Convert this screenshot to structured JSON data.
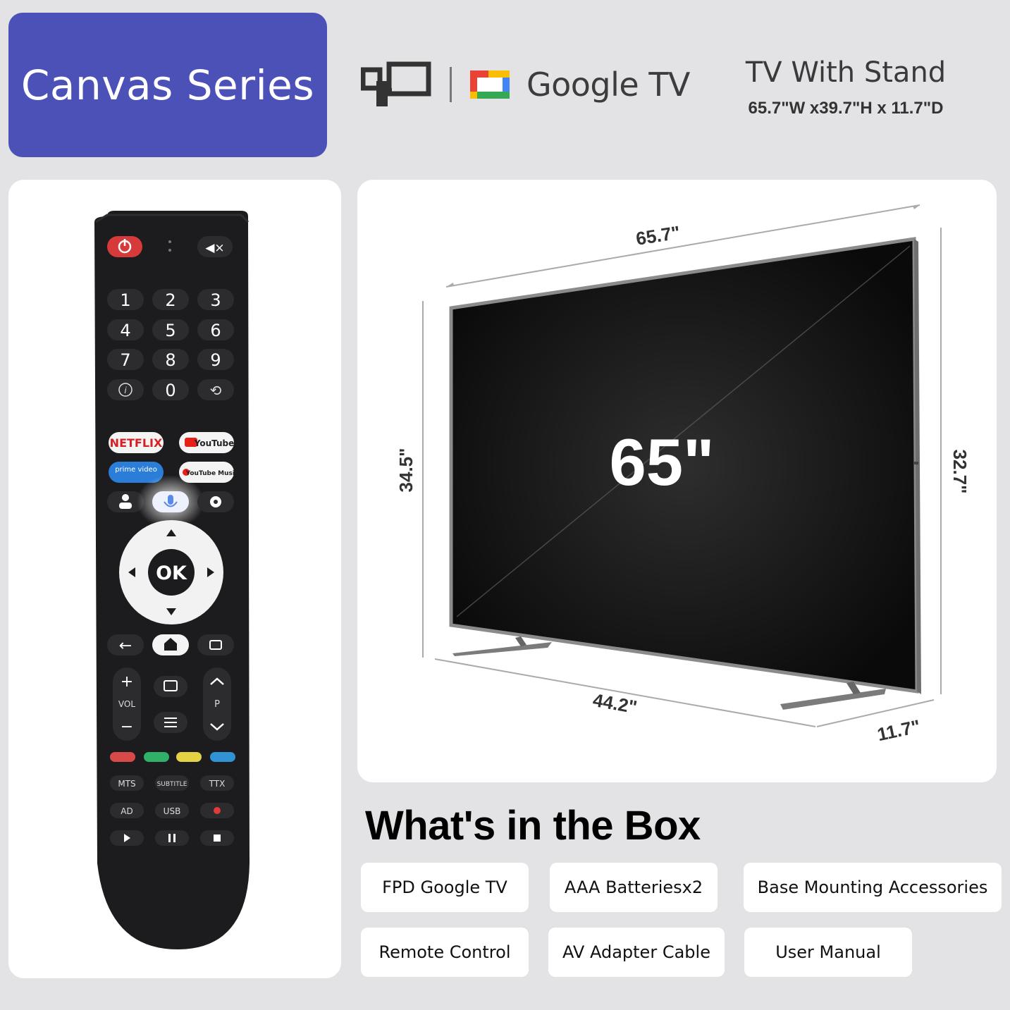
{
  "header": {
    "series_label": "Canvas Series",
    "brand_name": "Google TV",
    "stand_title": "TV With Stand",
    "stand_dimensions": "65.7\"W x39.7\"H x 11.7\"D",
    "colors": {
      "badge": "#4b51b6",
      "background": "#e3e3e5"
    }
  },
  "tv": {
    "screen_size": "65\"",
    "width_label": "65.7\"",
    "height_label": "32.7\"",
    "height_with_stand_label": "34.5\"",
    "stand_width_label": "44.2\"",
    "depth_label": "11.7\""
  },
  "remote": {
    "numbers": [
      "1",
      "2",
      "3",
      "4",
      "5",
      "6",
      "7",
      "8",
      "9",
      "0"
    ],
    "apps": [
      "NETFLIX",
      "YouTube",
      "prime video",
      "YouTube Music"
    ],
    "ok": "OK",
    "vol": "VOL",
    "p": "P",
    "row1": [
      "MTS",
      "SUBTITLE",
      "TTX"
    ],
    "row2": [
      "AD",
      "USB"
    ]
  },
  "box": {
    "title": "What's in the Box",
    "items": [
      "FPD Google TV",
      "AAA Batteriesx2",
      "Base Mounting Accessories",
      "Remote Control",
      "AV Adapter Cable",
      "User Manual"
    ]
  }
}
